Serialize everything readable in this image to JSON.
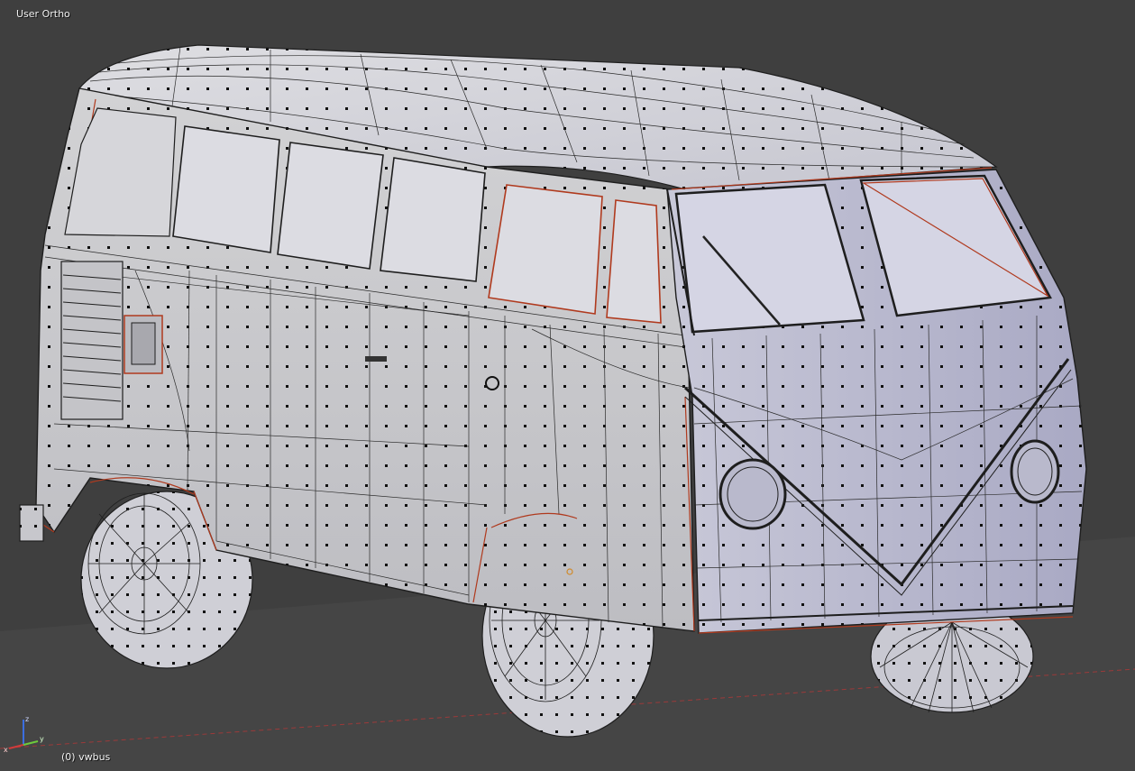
{
  "viewport": {
    "view_name": "User Ortho",
    "object_info": "(0) vwbus",
    "colors": {
      "background": "#3f3f3f",
      "ground": "#454545",
      "mesh_face": "#cdcdd0",
      "mesh_face_front": "#c3c3d6",
      "glass": "#dddde6",
      "wire": "#1e1e1e",
      "seam": "#b03a1e",
      "x_axis_line": "#9b3a3a",
      "axis_x": "#d13b3b",
      "axis_y": "#6ecb3b",
      "axis_z": "#3b6ee0"
    },
    "icons": [
      "axis-gizmo-icon"
    ]
  }
}
